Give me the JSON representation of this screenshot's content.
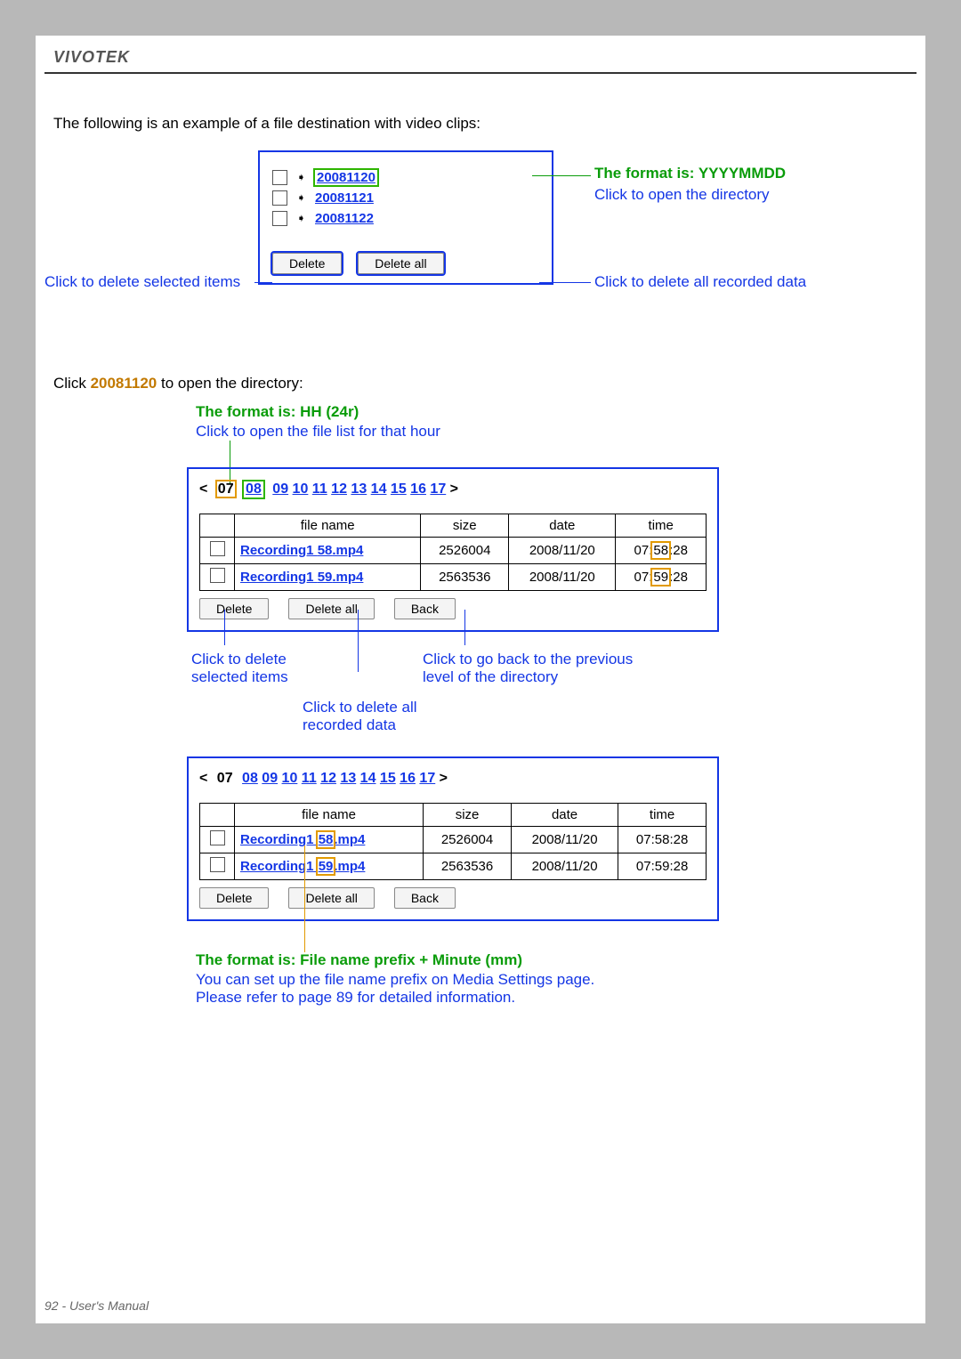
{
  "header": {
    "brand": "VIVOTEK"
  },
  "intro": "The following is an example of a file destination with video clips:",
  "date_list": {
    "items": [
      "20081120",
      "20081121",
      "20081122"
    ],
    "delete_btn": "Delete",
    "delete_all_btn": "Delete all",
    "callout_format": "The format is: YYYYMMDD",
    "callout_open": "Click to open the directory",
    "callout_delete_selected": "Click to delete selected items",
    "callout_delete_all": "Click to delete all recorded data"
  },
  "click_open_sentence_prefix": "Click ",
  "click_open_sentence_link": "20081120",
  "click_open_sentence_suffix": " to open the directory:",
  "hour_format_title": "The format is: HH (24r)",
  "hour_format_sub": "Click to open the file list for that hour",
  "hours": {
    "nav_left": "<",
    "nav_right": ">",
    "current": "07",
    "list": [
      "08",
      "09",
      "10",
      "11",
      "12",
      "13",
      "14",
      "15",
      "16",
      "17"
    ]
  },
  "file_table": {
    "headers": {
      "filename": "file name",
      "size": "size",
      "date": "date",
      "time": "time"
    },
    "rows": [
      {
        "filename_prefix": "Recording1",
        "filename_minute": "58",
        "filename_ext": ".mp4",
        "size": "2526004",
        "date": "2008/11/20",
        "time_h": "07",
        "time_m": "58",
        "time_s": "28"
      },
      {
        "filename_prefix": "Recording1",
        "filename_minute": "59",
        "filename_ext": ".mp4",
        "size": "2563536",
        "date": "2008/11/20",
        "time_h": "07",
        "time_m": "59",
        "time_s": "28"
      }
    ],
    "delete_btn": "Delete",
    "delete_all_btn": "Delete all",
    "back_btn": "Back"
  },
  "callouts_files": {
    "delete_selected": "Click to delete selected items",
    "delete_all": "Click to delete all recorded data",
    "go_back": "Click to go back to the previous level of the directory"
  },
  "filename_format_title": "The format is: File name prefix + Minute (mm)",
  "filename_format_body": "You can set up the file name prefix on Media Settings page. Please refer to page 89 for detailed information.",
  "footer": "92 - User's Manual"
}
